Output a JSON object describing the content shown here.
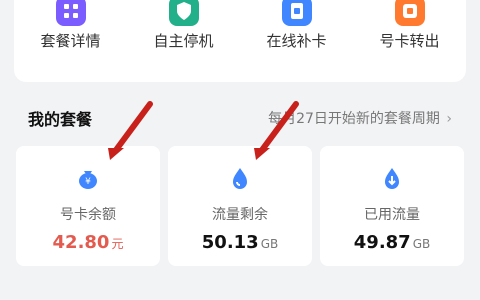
{
  "services": [
    {
      "label": "套餐详情",
      "icon": "grid-icon",
      "color": "#7b5cff"
    },
    {
      "label": "自主停机",
      "icon": "shield-icon",
      "color": "#22b08a"
    },
    {
      "label": "在线补卡",
      "icon": "sim-card-icon",
      "color": "#3f86ff"
    },
    {
      "label": "号卡转出",
      "icon": "transfer-icon",
      "color": "#ff7a2e"
    }
  ],
  "section": {
    "title": "我的套餐",
    "cycle_text": "每月27日开始新的套餐周期"
  },
  "stats": [
    {
      "label": "号卡余额",
      "value": "42.80",
      "unit": "元",
      "value_color": "#e35a4f",
      "icon": "money-bag-icon",
      "icon_color": "#3f86ff"
    },
    {
      "label": "流量剩余",
      "value": "50.13",
      "unit": "GB",
      "value_color": "#111111",
      "icon": "water-drop-icon",
      "icon_color": "#3f86ff"
    },
    {
      "label": "已用流量",
      "value": "49.87",
      "unit": "GB",
      "value_color": "#111111",
      "icon": "download-drop-icon",
      "icon_color": "#3f86ff"
    }
  ],
  "annotation": {
    "arrow_color": "#c8211b"
  }
}
